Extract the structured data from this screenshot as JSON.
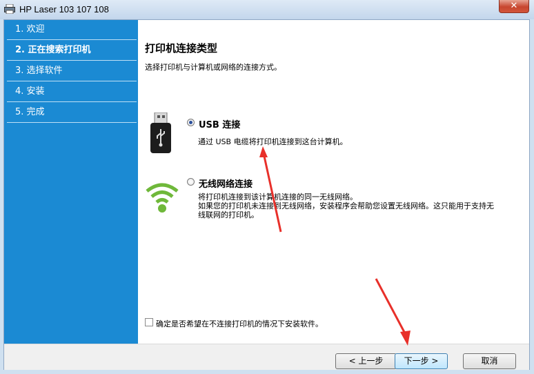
{
  "window": {
    "title": "HP Laser 103 107 108",
    "close_label": "✕"
  },
  "sidebar": {
    "steps": [
      {
        "label": "1. 欢迎"
      },
      {
        "label": "2. 正在搜索打印机"
      },
      {
        "label": "3. 选择软件"
      },
      {
        "label": "4. 安装"
      },
      {
        "label": "5. 完成"
      }
    ]
  },
  "main": {
    "heading": "打印机连接类型",
    "subheading": "选择打印机与计算机或网络的连接方式。",
    "options": [
      {
        "label": "USB 连接",
        "selected": true,
        "icon": "usb-drive-icon",
        "description": [
          "通过 USB 电缆将打印机连接到这台计算机。"
        ]
      },
      {
        "label": "无线网络连接",
        "selected": false,
        "icon": "wifi-icon",
        "description": [
          "将打印机连接到该计算机连接的同一无线网络。",
          "如果您的打印机未连接到无线网络，安装程序会帮助您设置无线网络。这只能用于支持无",
          "线联网的打印机。"
        ]
      }
    ],
    "checkbox": {
      "label": "确定是否希望在不连接打印机的情况下安装软件。",
      "checked": false
    }
  },
  "footer": {
    "back_label": "< 上一步",
    "next_label": "下一步 >",
    "cancel_label": "取消"
  },
  "colors": {
    "sidebar": "#1b8ad3",
    "annotation_arrow": "#e8302a"
  }
}
